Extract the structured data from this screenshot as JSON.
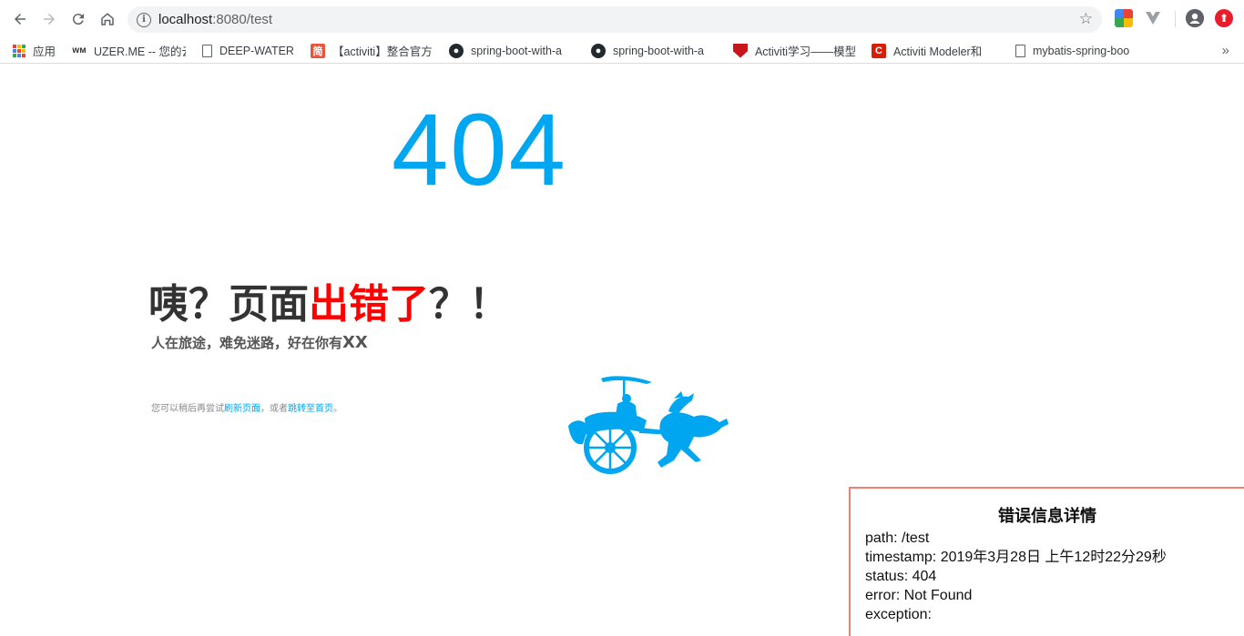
{
  "browser": {
    "url_host": "localhost",
    "url_path": ":8080/test",
    "bookmarks": [
      {
        "label": "应用",
        "icon": "apps-grid-icon"
      },
      {
        "label": "UZER.ME -- 您的云",
        "icon": "uzer-icon"
      },
      {
        "label": "DEEP-WATER",
        "icon": "page-icon"
      },
      {
        "label": "【activiti】整合官方",
        "icon": "jianshu-icon"
      },
      {
        "label": "spring-boot-with-a",
        "icon": "github-icon"
      },
      {
        "label": "spring-boot-with-a",
        "icon": "github-icon"
      },
      {
        "label": "Activiti学习——模型",
        "icon": "shield-icon"
      },
      {
        "label": "Activiti Modeler和",
        "icon": "csdn-icon"
      },
      {
        "label": "mybatis-spring-boo",
        "icon": "page-icon"
      }
    ],
    "more_label": "»"
  },
  "page": {
    "code": "404",
    "headline_prefix": "咦？页面",
    "headline_red": "出错了",
    "headline_suffix": "？！",
    "subtitle": "人在旅途，难免迷路，好在你有",
    "subtitle_xx": "XX",
    "hint_prefix": "您可以稍后再尝试",
    "hint_link1": "刷新页面",
    "hint_middle": "，或者",
    "hint_link2": "跳转至首页",
    "hint_suffix": "。"
  },
  "error_details": {
    "title": "错误信息详情",
    "path": "path: /test",
    "timestamp": "timestamp: 2019年3月28日 上午12时22分29秒",
    "status": "status: 404",
    "error": "error: Not Found",
    "exception": "exception:"
  },
  "colors": {
    "accent": "#00a6f0",
    "red": "#ff0000",
    "box_border": "#f08070"
  }
}
